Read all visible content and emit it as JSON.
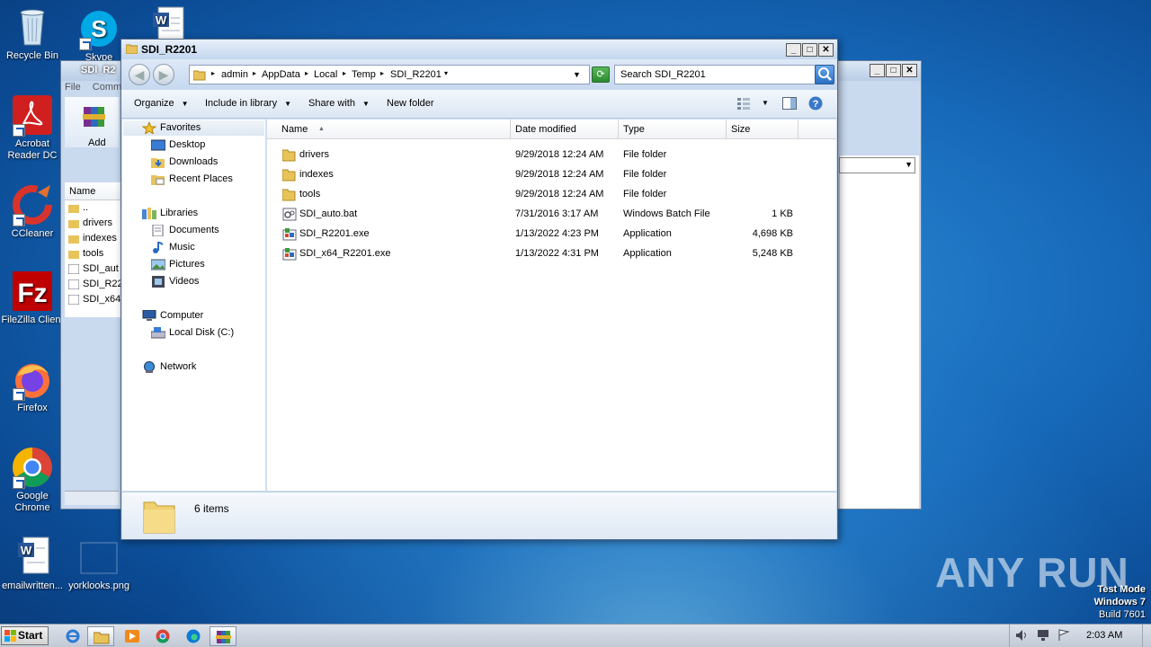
{
  "desktop": {
    "icons": [
      {
        "label": "Recycle Bin"
      },
      {
        "label": "Skype"
      },
      {
        "label": "Acrobat Reader DC"
      },
      {
        "label": "CCleaner"
      },
      {
        "label": "FileZilla Client"
      },
      {
        "label": "Firefox"
      },
      {
        "label": "Google Chrome"
      },
      {
        "label": "emailwritten..."
      },
      {
        "label": "yorklooks.png"
      }
    ]
  },
  "bg_window": {
    "title": "SDI_R2",
    "menu": [
      "File",
      "Comm"
    ],
    "add_label": "Add",
    "column_name": "Name",
    "items": [
      "..",
      "drivers",
      "indexes",
      "tools",
      "SDI_aut",
      "SDI_R22",
      "SDI_x64"
    ]
  },
  "window": {
    "title": "SDI_R2201",
    "breadcrumb": [
      "admin",
      "AppData",
      "Local",
      "Temp",
      "SDI_R2201"
    ],
    "search_placeholder": "Search SDI_R2201",
    "toolbar": {
      "organize": "Organize",
      "include_in_library": "Include in library",
      "share_with": "Share with",
      "new_folder": "New folder"
    },
    "nav": {
      "favorites": "Favorites",
      "desktop": "Desktop",
      "downloads": "Downloads",
      "recent_places": "Recent Places",
      "libraries": "Libraries",
      "documents": "Documents",
      "music": "Music",
      "pictures": "Pictures",
      "videos": "Videos",
      "computer": "Computer",
      "local_disk": "Local Disk (C:)",
      "network": "Network"
    },
    "columns": {
      "name": "Name",
      "date": "Date modified",
      "type": "Type",
      "size": "Size"
    },
    "files": [
      {
        "name": "drivers",
        "date": "9/29/2018 12:24 AM",
        "type": "File folder",
        "size": "",
        "icon": "folder-icon"
      },
      {
        "name": "indexes",
        "date": "9/29/2018 12:24 AM",
        "type": "File folder",
        "size": "",
        "icon": "folder-icon"
      },
      {
        "name": "tools",
        "date": "9/29/2018 12:24 AM",
        "type": "File folder",
        "size": "",
        "icon": "folder-icon"
      },
      {
        "name": "SDI_auto.bat",
        "date": "7/31/2016 3:17 AM",
        "type": "Windows Batch File",
        "size": "1 KB",
        "icon": "batch-file-icon"
      },
      {
        "name": "SDI_R2201.exe",
        "date": "1/13/2022 4:23 PM",
        "type": "Application",
        "size": "4,698 KB",
        "icon": "application-icon"
      },
      {
        "name": "SDI_x64_R2201.exe",
        "date": "1/13/2022 4:31 PM",
        "type": "Application",
        "size": "5,248 KB",
        "icon": "application-icon"
      }
    ],
    "status": "6 items"
  },
  "taskbar": {
    "start_label": "Start",
    "clock": "2:03 AM"
  },
  "watermark": "ANY RUN",
  "test_mode": {
    "line1": "Test Mode",
    "line2": "Windows 7",
    "line3": "Build 7601"
  }
}
